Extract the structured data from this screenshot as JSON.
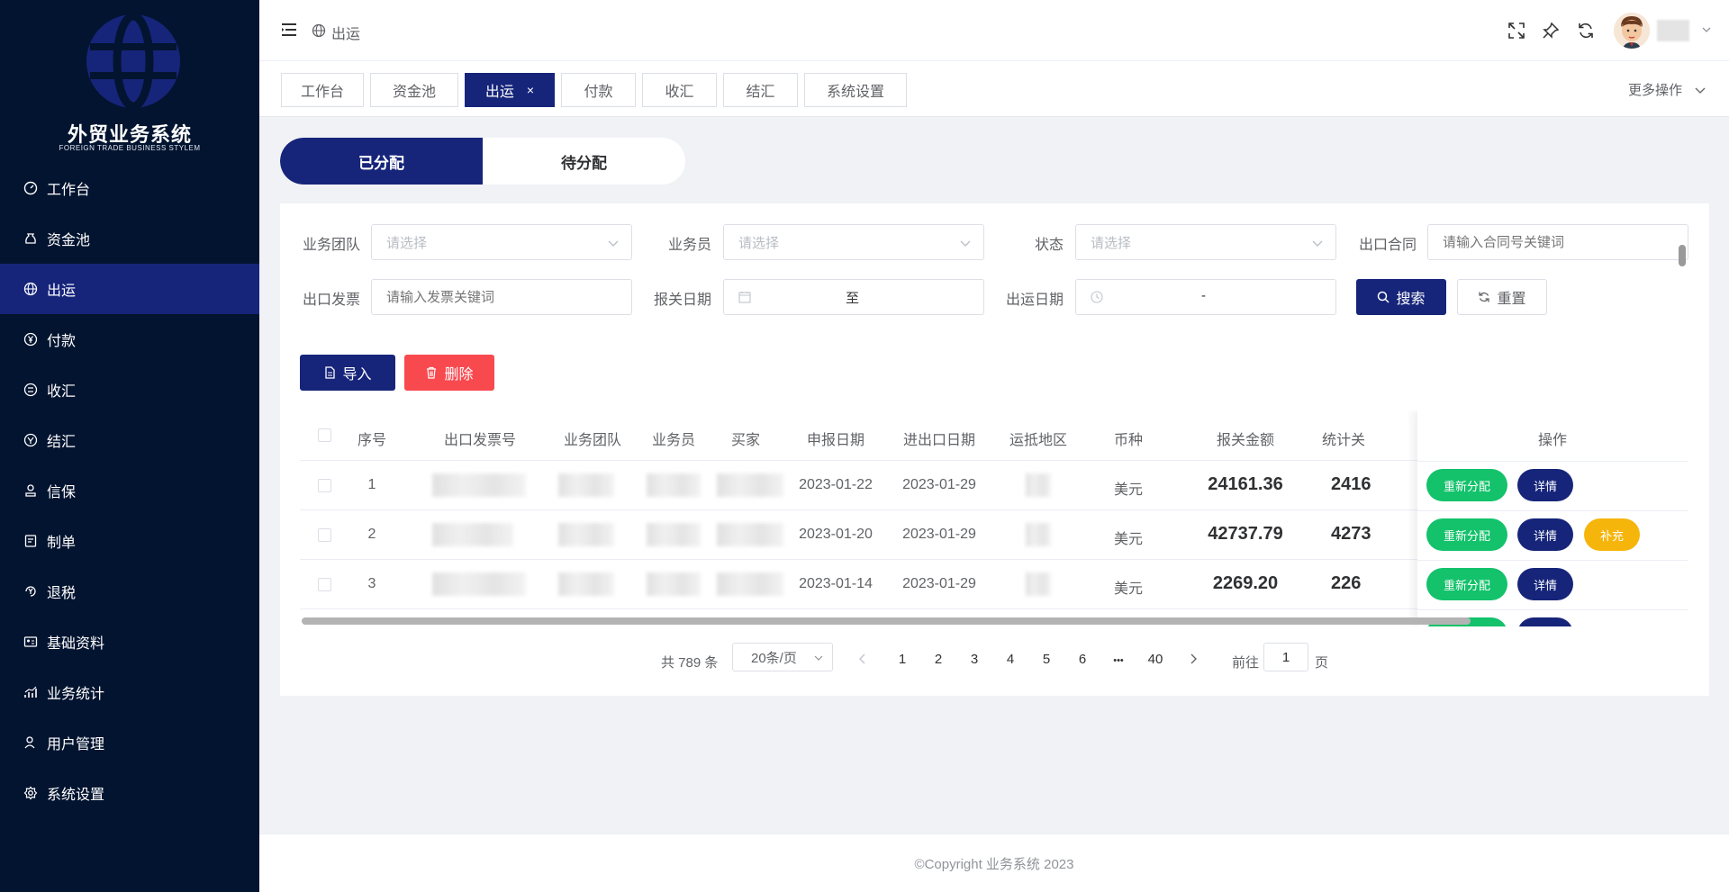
{
  "app": {
    "title": "外贸业务系统",
    "subtitle": "FOREIGN TRADE BUSINESS STYLEM"
  },
  "sidebar": {
    "items": [
      {
        "label": "工作台",
        "icon": "dashboard-icon"
      },
      {
        "label": "资金池",
        "icon": "money-bag-icon"
      },
      {
        "label": "出运",
        "icon": "globe-icon",
        "active": true
      },
      {
        "label": "付款",
        "icon": "yen-circle-icon"
      },
      {
        "label": "收汇",
        "icon": "exchange-in-icon"
      },
      {
        "label": "结汇",
        "icon": "exchange-settle-icon"
      },
      {
        "label": "信保",
        "icon": "stamp-icon"
      },
      {
        "label": "制单",
        "icon": "document-icon"
      },
      {
        "label": "退税",
        "icon": "tax-refund-icon"
      },
      {
        "label": "基础资料",
        "icon": "id-card-icon"
      },
      {
        "label": "业务统计",
        "icon": "stats-icon"
      },
      {
        "label": "用户管理",
        "icon": "user-icon"
      },
      {
        "label": "系统设置",
        "icon": "gear-icon"
      }
    ]
  },
  "header": {
    "breadcrumb": "出运"
  },
  "tabs": [
    {
      "label": "工作台"
    },
    {
      "label": "资金池"
    },
    {
      "label": "出运",
      "active": true,
      "close": "×"
    },
    {
      "label": "付款"
    },
    {
      "label": "收汇"
    },
    {
      "label": "结汇"
    },
    {
      "label": "系统设置"
    }
  ],
  "more_ops": "更多操作",
  "segment": {
    "assigned": "已分配",
    "unassigned": "待分配"
  },
  "filters": {
    "team_label": "业务团队",
    "team_placeholder": "请选择",
    "sales_label": "业务员",
    "sales_placeholder": "请选择",
    "status_label": "状态",
    "status_placeholder": "请选择",
    "contract_label": "出口合同",
    "contract_placeholder": "请输入合同号关键词",
    "invoice_label": "出口发票",
    "invoice_placeholder": "请输入发票关键词",
    "declare_label": "报关日期",
    "declare_sep": "至",
    "ship_label": "出运日期",
    "ship_sep": "-",
    "search": "搜索",
    "reset": "重置"
  },
  "actions": {
    "import": "导入",
    "delete": "删除"
  },
  "table": {
    "columns": [
      "序号",
      "出口发票号",
      "业务团队",
      "业务员",
      "买家",
      "申报日期",
      "进出口日期",
      "运抵地区",
      "币种",
      "报关金额",
      "统计关",
      "操作"
    ],
    "rows": [
      {
        "no": "1",
        "declare_date": "2023-01-22",
        "io_date": "2023-01-29",
        "currency": "美元",
        "amount": "24161.36",
        "stat": "2416",
        "ops": [
          "重新分配",
          "详情"
        ]
      },
      {
        "no": "2",
        "declare_date": "2023-01-20",
        "io_date": "2023-01-29",
        "currency": "美元",
        "amount": "42737.79",
        "stat": "4273",
        "ops": [
          "重新分配",
          "详情",
          "补充"
        ]
      },
      {
        "no": "3",
        "declare_date": "2023-01-14",
        "io_date": "2023-01-29",
        "currency": "美元",
        "amount": "2269.20",
        "stat": "226",
        "ops": [
          "重新分配",
          "详情"
        ]
      }
    ]
  },
  "pagination": {
    "total": "共 789 条",
    "page_size": "20条/页",
    "pages": [
      "1",
      "2",
      "3",
      "4",
      "5",
      "6",
      "•••",
      "40"
    ],
    "goto_label": "前往",
    "goto_value": "1",
    "goto_suffix": "页"
  },
  "footer": {
    "copyright": "©Copyright 业务系统 2023"
  },
  "colors": {
    "sidebar_bg": "#031430",
    "active": "#16257a",
    "green": "#13c26b",
    "danger": "#f8494f",
    "warning": "#f5b50b"
  }
}
